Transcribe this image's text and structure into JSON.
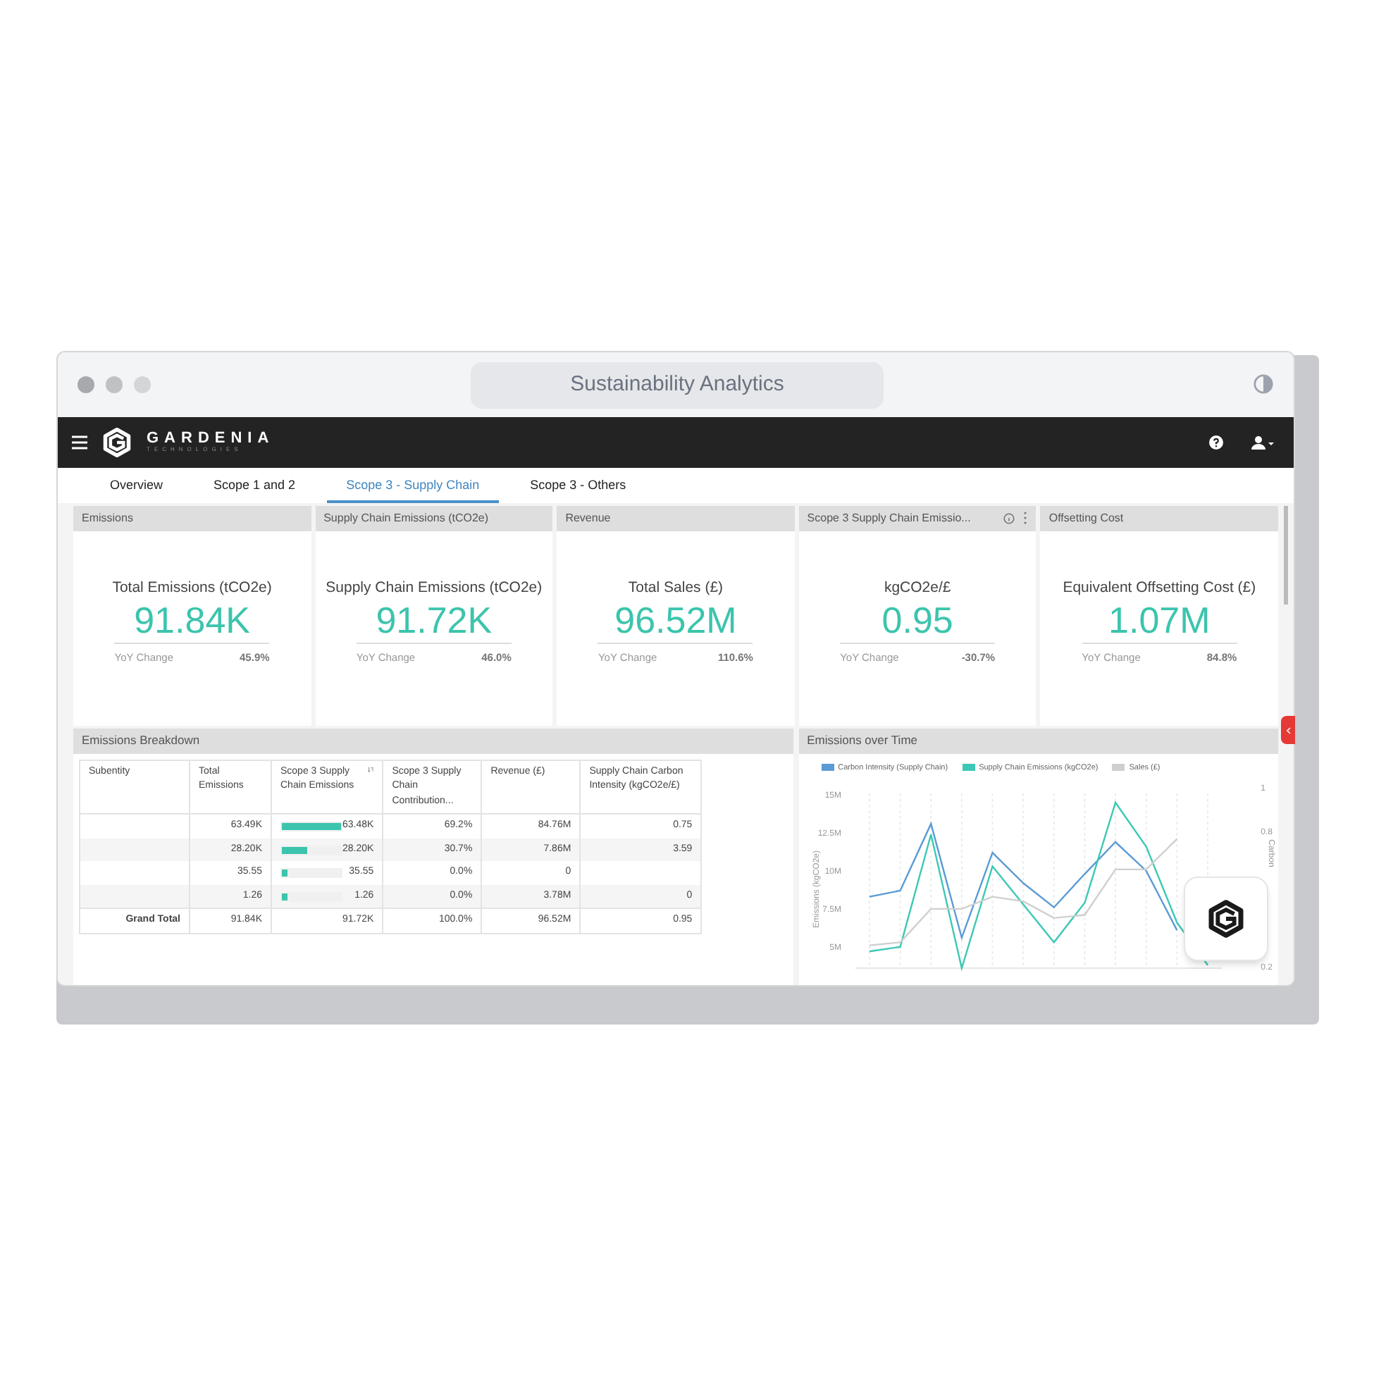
{
  "window": {
    "title": "Sustainability Analytics"
  },
  "brand": {
    "name": "GARDENIA",
    "tagline": "TECHNOLOGIES"
  },
  "tabs": [
    {
      "label": "Overview",
      "selected": false
    },
    {
      "label": "Scope 1 and 2",
      "selected": false
    },
    {
      "label": "Scope 3 - Supply Chain",
      "selected": true
    },
    {
      "label": "Scope 3 - Others",
      "selected": false
    }
  ],
  "kpis": [
    {
      "header": "Emissions",
      "label": "Total Emissions (tCO2e)",
      "value": "91.84K",
      "change_label": "YoY Change",
      "change": "45.9%",
      "has_menu": false
    },
    {
      "header": "Supply Chain Emissions (tCO2e)",
      "label": "Supply Chain Emissions (tCO2e)",
      "value": "91.72K",
      "change_label": "YoY Change",
      "change": "46.0%",
      "has_menu": false
    },
    {
      "header": "Revenue",
      "label": "Total Sales (£)",
      "value": "96.52M",
      "change_label": "YoY Change",
      "change": "110.6%",
      "has_menu": false
    },
    {
      "header": "Scope 3 Supply Chain Emissio...",
      "label": "kgCO2e/£",
      "value": "0.95",
      "change_label": "YoY Change",
      "change": "-30.7%",
      "has_menu": true
    },
    {
      "header": "Offsetting Cost",
      "label": "Equivalent Offsetting Cost (£)",
      "value": "1.07M",
      "change_label": "YoY Change",
      "change": "84.8%",
      "has_menu": false
    }
  ],
  "breakdown": {
    "title": "Emissions Breakdown",
    "columns": [
      "Subentity",
      "Total Emissions",
      "Scope 3 Supply Chain Emissions",
      "Scope 3 Supply Chain Contribution...",
      "Revenue (£)",
      "Supply Chain Carbon Intensity (kgCO2e/£)"
    ],
    "rows": [
      {
        "total": "63.49K",
        "scope3": "63.48K",
        "level": 1,
        "contribution": "69.2%",
        "revenue": "84.76M",
        "intensity": "0.75"
      },
      {
        "total": "28.20K",
        "scope3": "28.20K",
        "level": 0.44,
        "contribution": "30.7%",
        "revenue": "7.86M",
        "intensity": "3.59"
      },
      {
        "total": "35.55",
        "scope3": "35.55",
        "level": 0.05,
        "contribution": "0.0%",
        "revenue": "0",
        "intensity": ""
      },
      {
        "total": "1.26",
        "scope3": "1.26",
        "level": 0.05,
        "contribution": "0.0%",
        "revenue": "3.78M",
        "intensity": "0"
      }
    ],
    "total_row": {
      "label": "Grand Total",
      "total": "91.84K",
      "scope3": "91.72K",
      "contribution": "100.0%",
      "revenue": "96.52M",
      "intensity": "0.95"
    }
  },
  "chart_panel": {
    "title": "Emissions over Time",
    "right_axis": {
      "label": "Carbon",
      "ticks": [
        "1",
        "0.8",
        "0.2"
      ]
    },
    "chart_data": {
      "type": "line",
      "ylabel": "Emissions (kgCO2e)",
      "grid": true,
      "ylim": [
        3.5,
        15
      ],
      "yticks": [
        {
          "value": 5,
          "label": "5M"
        },
        {
          "value": 7.5,
          "label": "7.5M"
        },
        {
          "value": 10,
          "label": "10M"
        },
        {
          "value": 12.5,
          "label": "12.5M"
        },
        {
          "value": 15,
          "label": "15M"
        }
      ],
      "series": [
        {
          "name": "Carbon Intensity (Supply Chain)",
          "color": "#5b9bd5",
          "values": [
            8.2,
            8.6,
            13,
            5.5,
            11.1,
            9.1,
            7.5,
            9.7,
            11.8,
            9.9,
            6,
            null
          ]
        },
        {
          "name": "Supply Chain Emissions (kgCO2e)",
          "color": "#3cc8b4",
          "values": [
            4.6,
            4.9,
            12.3,
            3.5,
            10.2,
            7.7,
            5.2,
            7.8,
            14.4,
            11.5,
            6.5,
            3.7
          ]
        },
        {
          "name": "Sales (£)",
          "color": "#cfcfcf",
          "values": [
            5,
            5.2,
            7.4,
            7.4,
            8.2,
            7.9,
            6.8,
            7,
            10,
            10,
            12,
            null
          ]
        }
      ]
    }
  }
}
